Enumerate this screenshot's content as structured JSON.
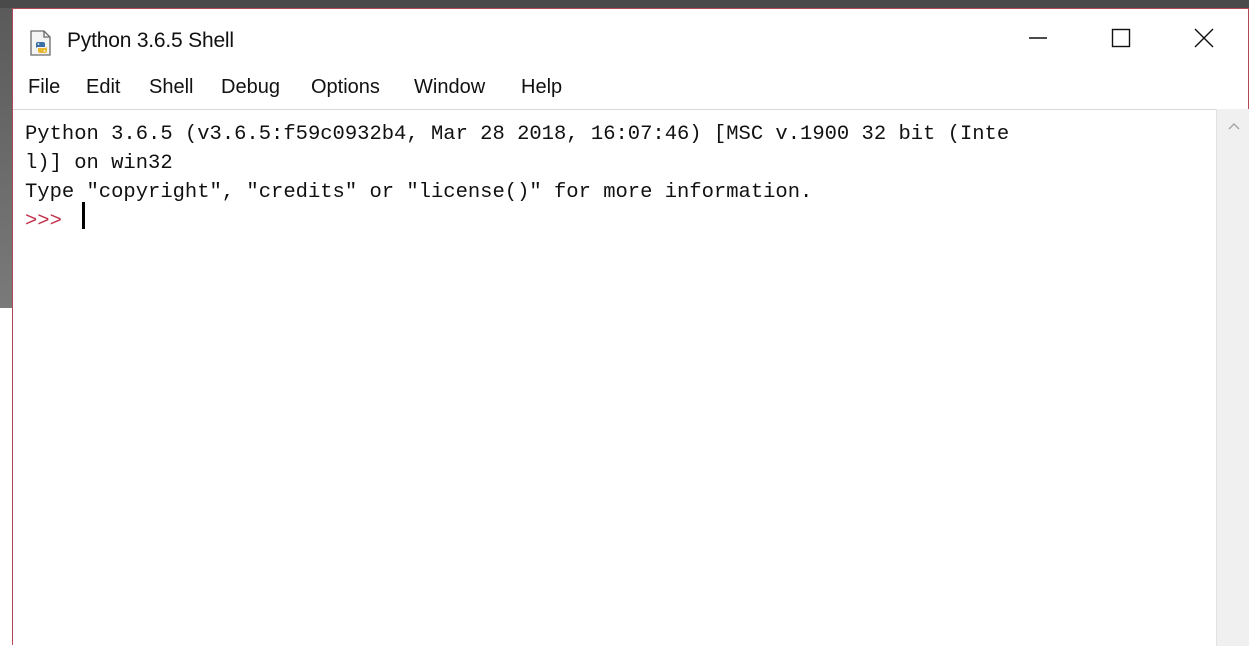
{
  "window": {
    "title": "Python 3.6.5 Shell",
    "icon": "python-idle-icon",
    "controls": [
      "minimize-icon",
      "maximize-icon",
      "close-icon"
    ]
  },
  "menubar": {
    "items": [
      "File",
      "Edit",
      "Shell",
      "Debug",
      "Options",
      "Window",
      "Help"
    ]
  },
  "shell": {
    "lines": [
      "Python 3.6.5 (v3.6.5:f59c0932b4, Mar 28 2018, 16:07:46) [MSC v.1900 32 bit (Inte",
      "l)] on win32",
      "Type \"copyright\", \"credits\" or \"license()\" for more information."
    ],
    "prompt": ">>>",
    "input": ""
  },
  "colors": {
    "prompt": "#c0304a",
    "window_border": "#b24a55",
    "text": "#111111"
  }
}
